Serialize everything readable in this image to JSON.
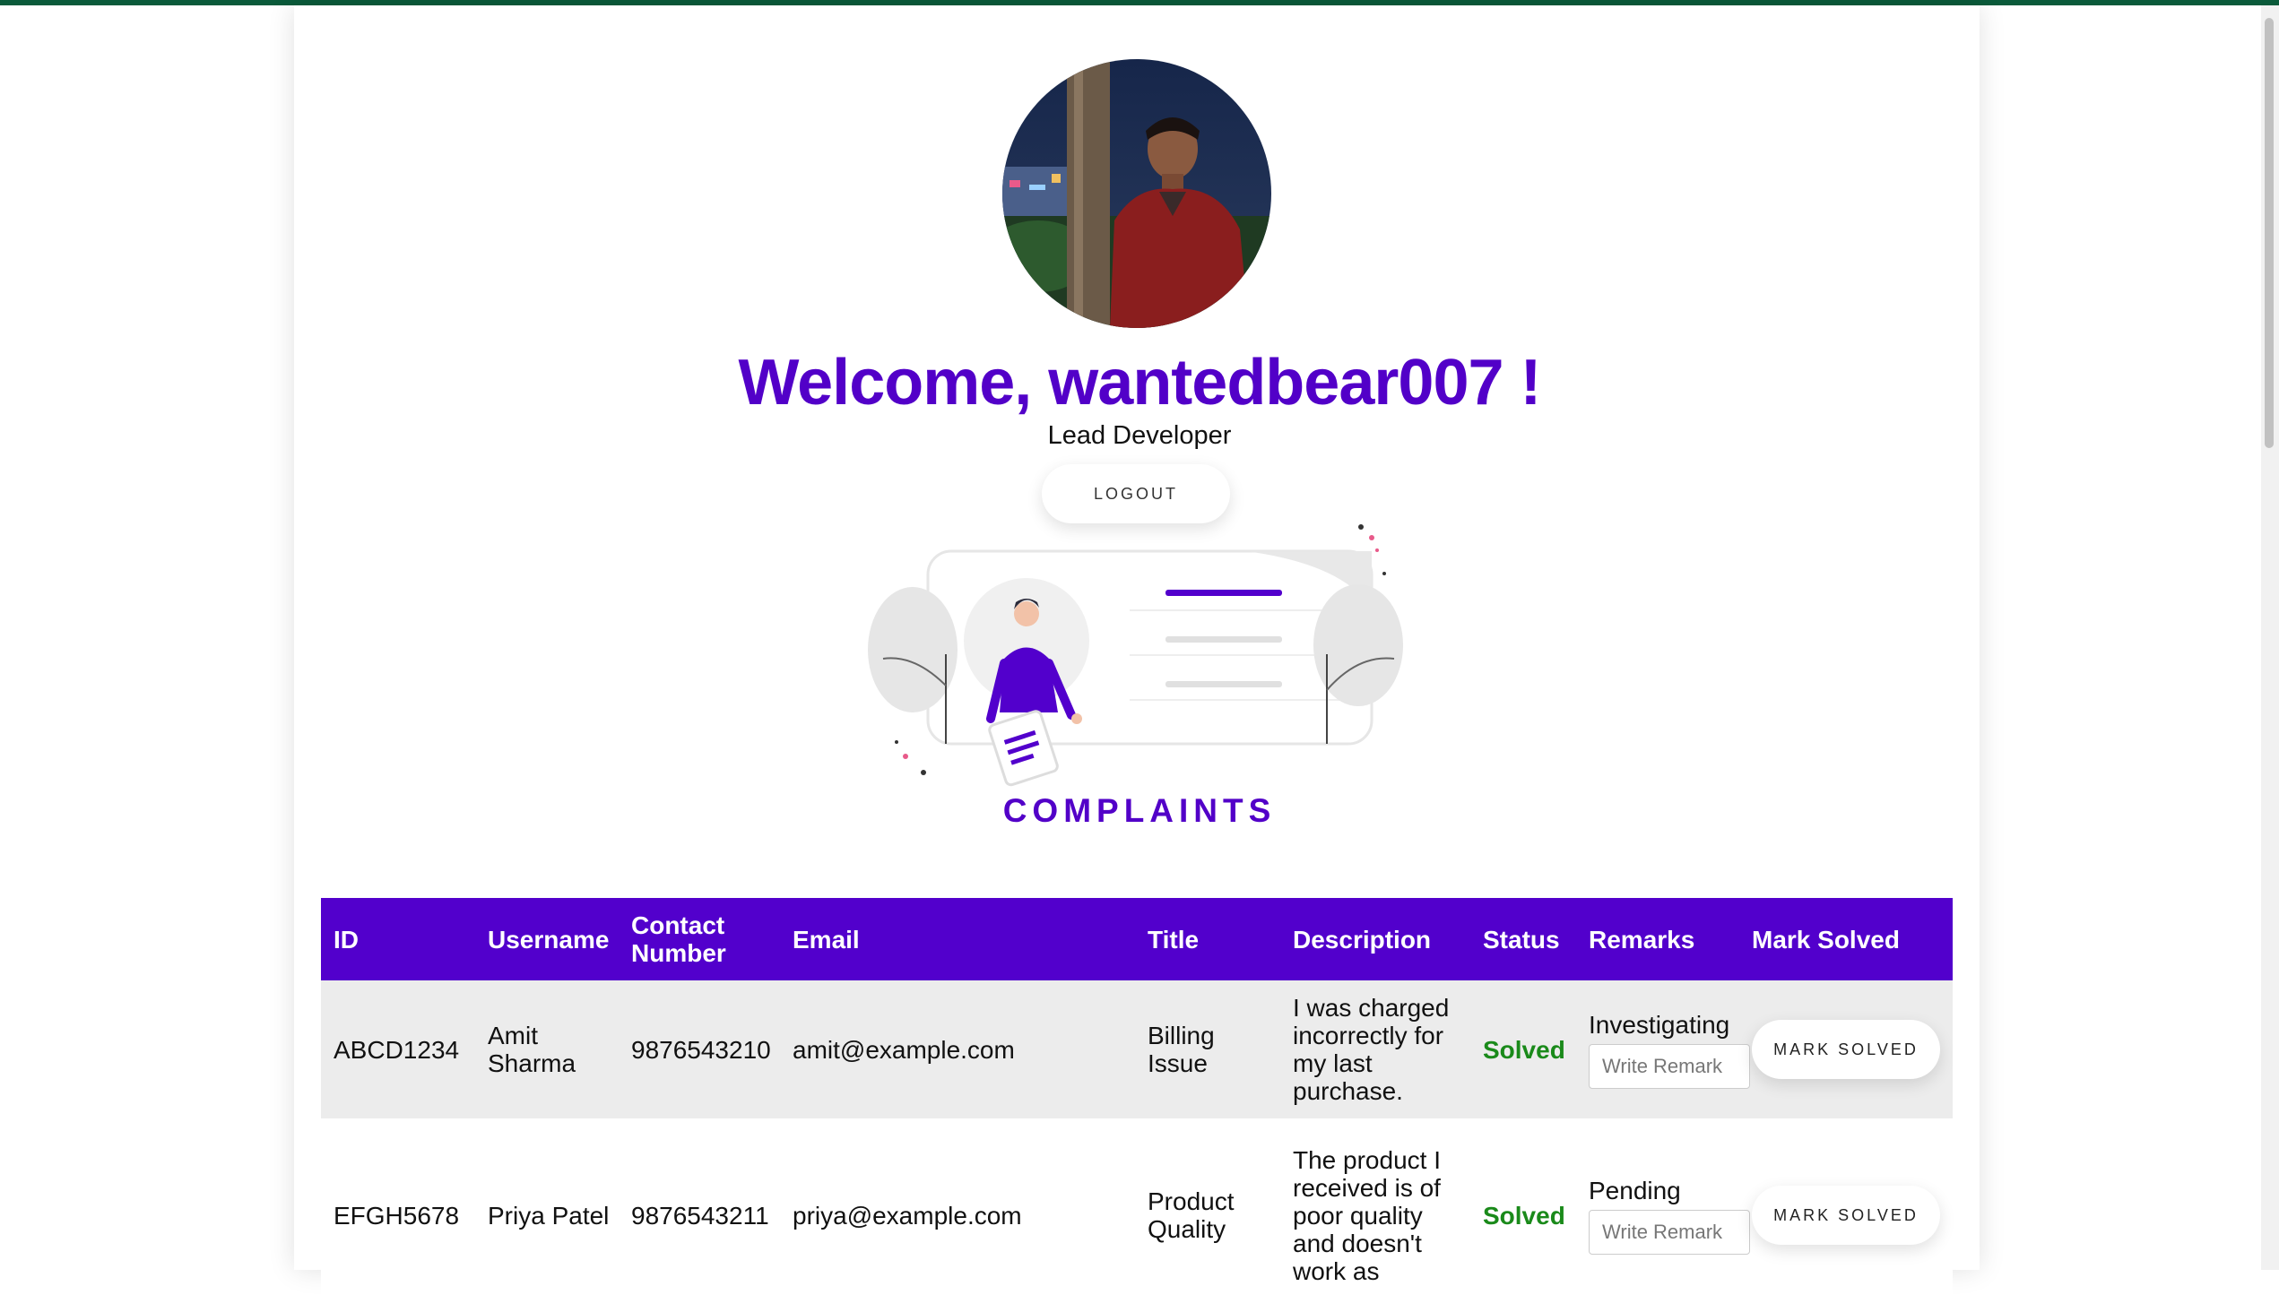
{
  "header": {
    "welcome_prefix": "Welcome, ",
    "username": "wantedbear007",
    "welcome_suffix": " !",
    "role": "Lead Developer",
    "logout_label": "LOGOUT"
  },
  "section": {
    "title": "COMPLAINTS"
  },
  "table": {
    "headers": [
      "ID",
      "Username",
      "Contact Number",
      "Email",
      "Title",
      "Description",
      "Status",
      "Remarks",
      "Mark Solved"
    ],
    "rows": [
      {
        "id": "ABCD1234",
        "username": "Amit Sharma",
        "contact": "9876543210",
        "email": "amit@example.com",
        "title": "Billing Issue",
        "description": "I was charged incorrectly for my last purchase.",
        "status": "Solved",
        "remark": "Investigating",
        "remark_placeholder": "Write Remark",
        "button": "MARK SOLVED"
      },
      {
        "id": "EFGH5678",
        "username": "Priya Patel",
        "contact": "9876543211",
        "email": "priya@example.com",
        "title": "Product Quality",
        "description": "The product I received is of poor quality and doesn't work as",
        "status": "Solved",
        "remark": "Pending",
        "remark_placeholder": "Write Remark",
        "button": "MARK SOLVED"
      }
    ]
  },
  "colors": {
    "accent": "#5200cc",
    "status_solved": "#1a8a1a",
    "topbar": "#0a5a3a"
  }
}
